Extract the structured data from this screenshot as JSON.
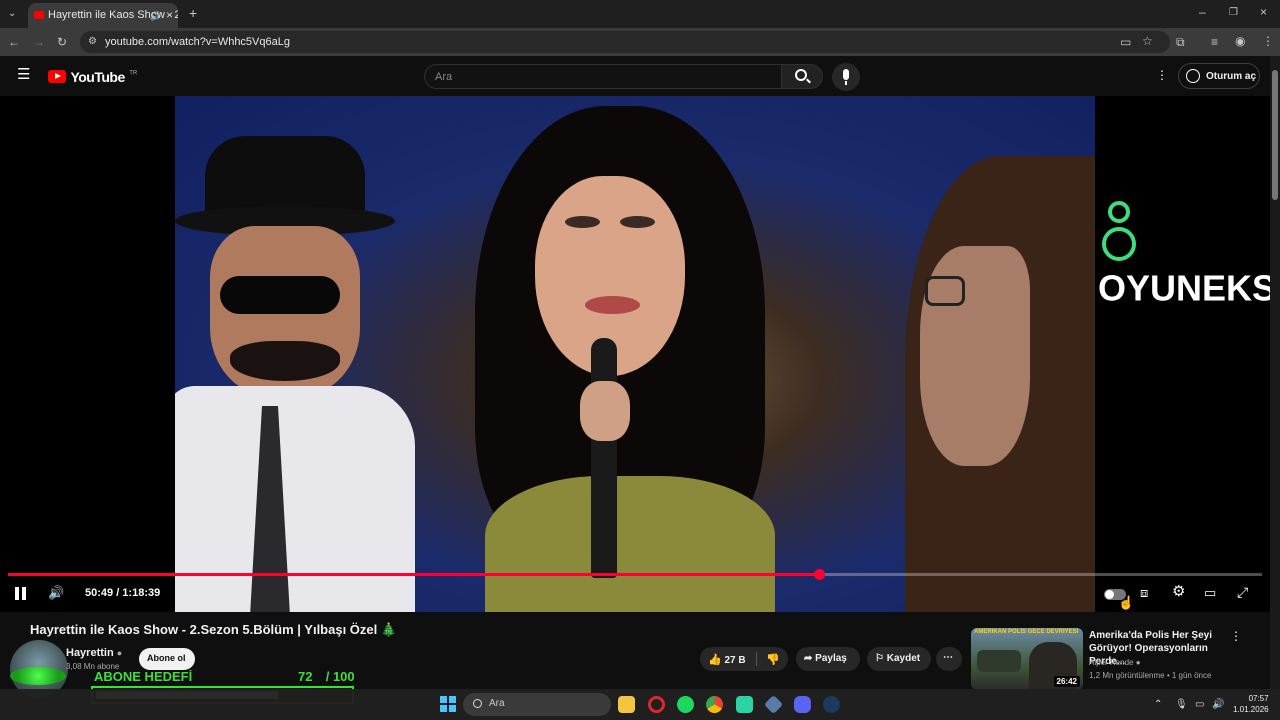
{
  "browser": {
    "tab_title": "Hayrettin ile Kaos Show - 2.",
    "url": "youtube.com/watch?v=Whhc5Vq6aLg"
  },
  "youtube": {
    "logo_text": "YouTube",
    "region": "TR",
    "search_placeholder": "Ara",
    "signin_label": "Oturum aç"
  },
  "player": {
    "time_display": "50:49 / 1:18:39",
    "progress_fraction": 0.647,
    "watermark": "OYUNEKS"
  },
  "video_info": {
    "title": "Hayrettin ile Kaos Show - 2.Sezon 5.Bölüm | Yılbaşı Özel 🎄",
    "channel_name": "Hayrettin",
    "subscribers": "3,08 Mn abone",
    "subscribe_label": "Abone ol",
    "likes": "27 B",
    "share_label": "Paylaş",
    "save_label": "Kaydet"
  },
  "subscriber_goal": {
    "label": "ABONE HEDEFİ",
    "current": "72",
    "target": "/ 100",
    "fraction": 0.72
  },
  "recommended": {
    "thumb_text": "AMERİKAN POLİS GECE DEVRİYESİ",
    "duration": "26:42",
    "title": "Amerika'da Polis Her Şeyi Görüyor! Operasyonların Perde...",
    "channel": "Alper Rende",
    "meta": "1,2 Mn görüntülenme • 1 gün önce"
  },
  "taskbar": {
    "search_placeholder": "Ara",
    "time": "07:57",
    "date": "1.01.2026"
  },
  "colors": {
    "accent_red": "#ff0033",
    "goal_green": "#2ee82e"
  }
}
